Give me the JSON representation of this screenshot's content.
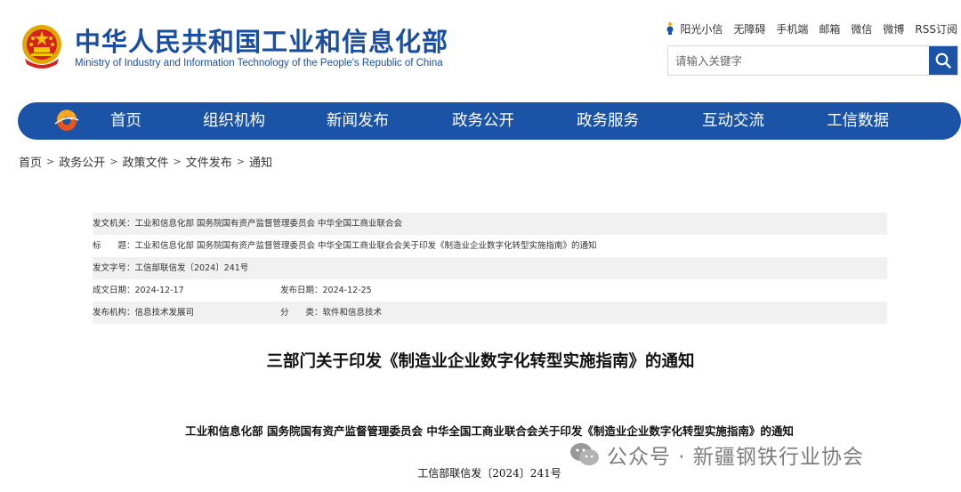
{
  "header": {
    "site_title": "中华人民共和国工业和信息化部",
    "site_subtitle": "Ministry of Industry and Information Technology of the People's Republic of China",
    "top_links": [
      "阳光小信",
      "无障碍",
      "手机端",
      "邮箱",
      "微信",
      "微博",
      "RSS订阅"
    ],
    "search_placeholder": "请输入关键字",
    "brand_color": "#1b54a6"
  },
  "nav": {
    "items": [
      "首页",
      "组织机构",
      "新闻发布",
      "政务公开",
      "政务服务",
      "互动交流",
      "工信数据"
    ]
  },
  "breadcrumb": [
    "首页",
    "政务公开",
    "政策文件",
    "文件发布",
    "通知"
  ],
  "meta": {
    "issuer": "发文机关：工业和信息化部 国务院国有资产监督管理委员会 中华全国工商业联合会",
    "title": "标　　题：工业和信息化部 国务院国有资产监督管理委员会 中华全国工商业联合会关于印发《制造业企业数字化转型实施指南》的通知",
    "doc_number": "发文字号：工信部联信发〔2024〕241号",
    "written_date": "成文日期：2024-12-17",
    "publish_date": "发布日期：2024-12-25",
    "agency": "发布机构：信息技术发展司",
    "category": "分　　类：软件和信息技术"
  },
  "article": {
    "title": "三部门关于印发《制造业企业数字化转型实施指南》的通知",
    "subtitle": "工业和信息化部 国务院国有资产监督管理委员会 中华全国工商业联合会关于印发《制造业企业数字化转型实施指南》的通知",
    "doc_number": "工信部联信发〔2024〕241号"
  },
  "watermark": {
    "text": "公众号 · 新疆钢铁行业协会"
  }
}
